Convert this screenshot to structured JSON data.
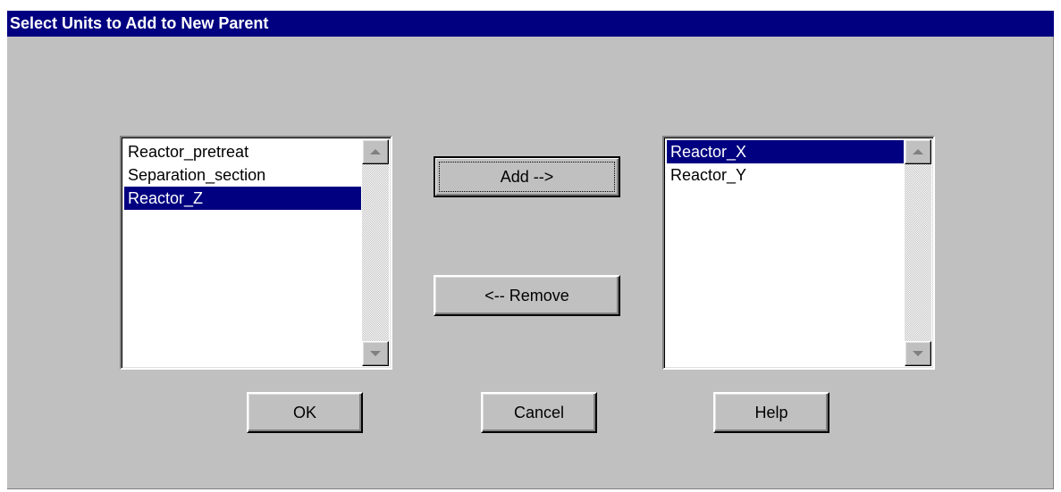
{
  "dialog": {
    "title": "Select Units to Add to New Parent"
  },
  "available_list": {
    "items": [
      {
        "label": "Reactor_pretreat",
        "selected": false
      },
      {
        "label": "Separation_section",
        "selected": false
      },
      {
        "label": "Reactor_Z",
        "selected": true
      }
    ]
  },
  "selected_list": {
    "items": [
      {
        "label": "Reactor_X",
        "selected": true
      },
      {
        "label": "Reactor_Y",
        "selected": false
      }
    ]
  },
  "buttons": {
    "add": "Add -->",
    "remove": "<-- Remove",
    "ok": "OK",
    "cancel": "Cancel",
    "help": "Help"
  },
  "icons": {
    "scroll_up": "scroll-up-arrow-icon",
    "scroll_down": "scroll-down-arrow-icon"
  },
  "colors": {
    "title_bar": "#000080",
    "face": "#c0c0c0",
    "selection": "#000080"
  }
}
